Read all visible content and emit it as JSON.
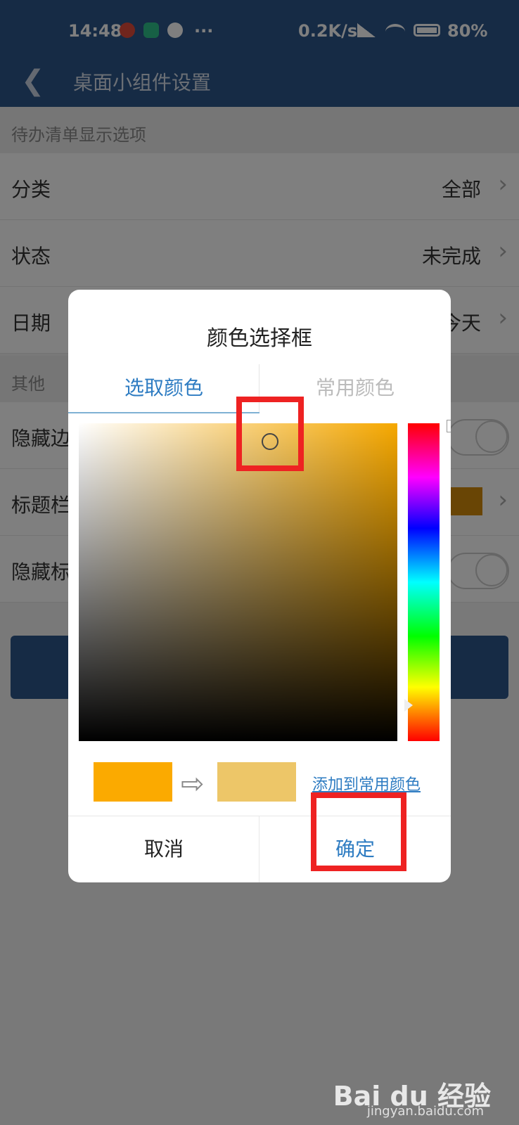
{
  "statusbar": {
    "time": "14:48",
    "dots": "···",
    "speed": "0.2K/s",
    "battery": "80%"
  },
  "appbar": {
    "back": "❮",
    "title": "桌面小组件设置"
  },
  "sections": {
    "todo": "待办清单显示选项",
    "other": "其他"
  },
  "rows": [
    {
      "label": "分类",
      "value": "全部"
    },
    {
      "label": "状态",
      "value": "未完成"
    },
    {
      "label": "日期",
      "value": "今天"
    },
    {
      "label": "隐藏边"
    },
    {
      "label": "标题栏"
    },
    {
      "label": "隐藏标"
    }
  ],
  "chevron": "›",
  "dialog": {
    "title": "颜色选择框",
    "tabs": [
      "选取颜色",
      "常用颜色"
    ],
    "add_link": "添加到常用颜色",
    "cancel": "取消",
    "ok": "确定",
    "arrow": "⇨"
  },
  "colors": {
    "current": "#fbaa00",
    "new": "#edc668",
    "accent": "#2e7cc2",
    "header": "#2d568a"
  },
  "watermark": {
    "brand": "Bai du 经验",
    "url": "jingyan.baidu.com"
  }
}
